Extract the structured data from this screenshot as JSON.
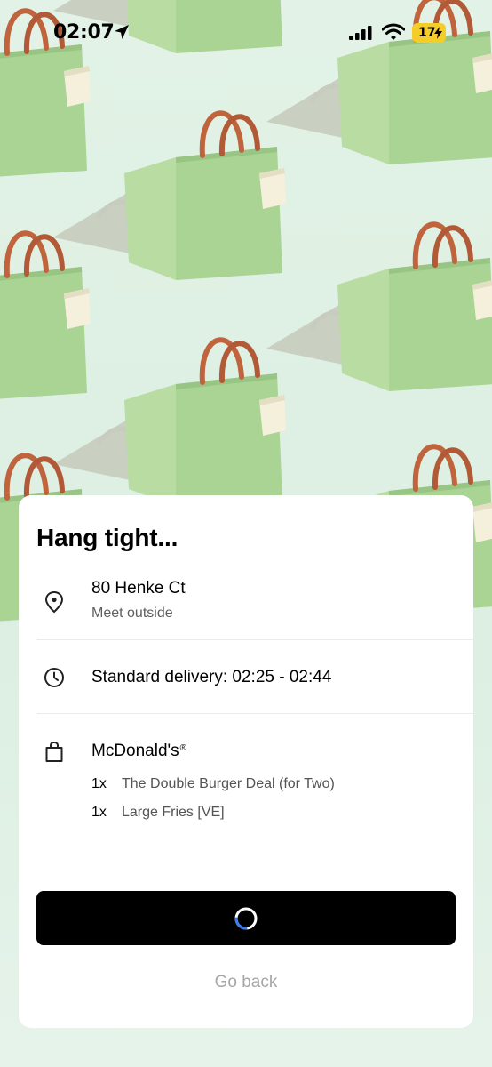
{
  "status_bar": {
    "time": "02:07",
    "battery": "17"
  },
  "sheet": {
    "title": "Hang tight...",
    "address": {
      "line1": "80 Henke Ct",
      "note": "Meet outside"
    },
    "delivery": {
      "text": "Standard delivery: 02:25 - 02:44"
    },
    "order": {
      "store": "McDonald's",
      "registered_mark": "®",
      "items": [
        {
          "qty": "1x",
          "name": "The Double Burger Deal (for Two)"
        },
        {
          "qty": "1x",
          "name": "Large Fries [VE]"
        }
      ]
    },
    "go_back_label": "Go back"
  },
  "colors": {
    "background": "#e2f2e6",
    "bag_green": "#a9d493",
    "bag_handle": "#c0643e",
    "button": "#000000",
    "spinner_accent": "#3e7bf0",
    "battery": "#f4cd2a"
  },
  "icons": {
    "location": "location-pin-icon",
    "clock": "clock-icon",
    "bag": "shopping-bag-icon"
  }
}
